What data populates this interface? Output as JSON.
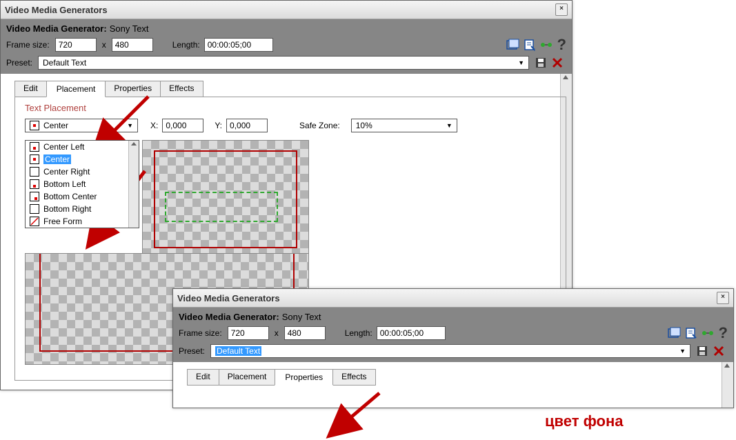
{
  "win1": {
    "title": "Video Media Generators",
    "generator_label": "Video Media Generator:",
    "generator_name": "Sony Text",
    "frame_size_label": "Frame size:",
    "frame_w": "720",
    "frame_h": "480",
    "frame_x": "x",
    "length_label": "Length:",
    "length_value": "00:00:05;00",
    "preset_label": "Preset:",
    "preset_value": "Default Text",
    "tabs": {
      "edit": "Edit",
      "placement": "Placement",
      "properties": "Properties",
      "effects": "Effects"
    },
    "fieldset": "Text Placement",
    "placement_selected": "Center",
    "x_label": "X:",
    "x_value": "0,000",
    "y_label": "Y:",
    "y_value": "0,000",
    "safezone_label": "Safe Zone:",
    "safezone_value": "10%",
    "dropdown": {
      "center_left": "Center Left",
      "center": "Center",
      "center_right": "Center Right",
      "bottom_left": "Bottom Left",
      "bottom_center": "Bottom Center",
      "bottom_right": "Bottom Right",
      "free_form": "Free Form"
    }
  },
  "win2": {
    "title": "Video Media Generators",
    "generator_label": "Video Media Generator:",
    "generator_name": "Sony Text",
    "frame_size_label": "Frame size:",
    "frame_w": "720",
    "frame_h": "480",
    "frame_x": "x",
    "length_label": "Length:",
    "length_value": "00:00:05;00",
    "preset_label": "Preset:",
    "preset_value": "Default Text",
    "tabs": {
      "edit": "Edit",
      "placement": "Placement",
      "properties": "Properties",
      "effects": "Effects"
    }
  },
  "annotation": "цвет фона"
}
